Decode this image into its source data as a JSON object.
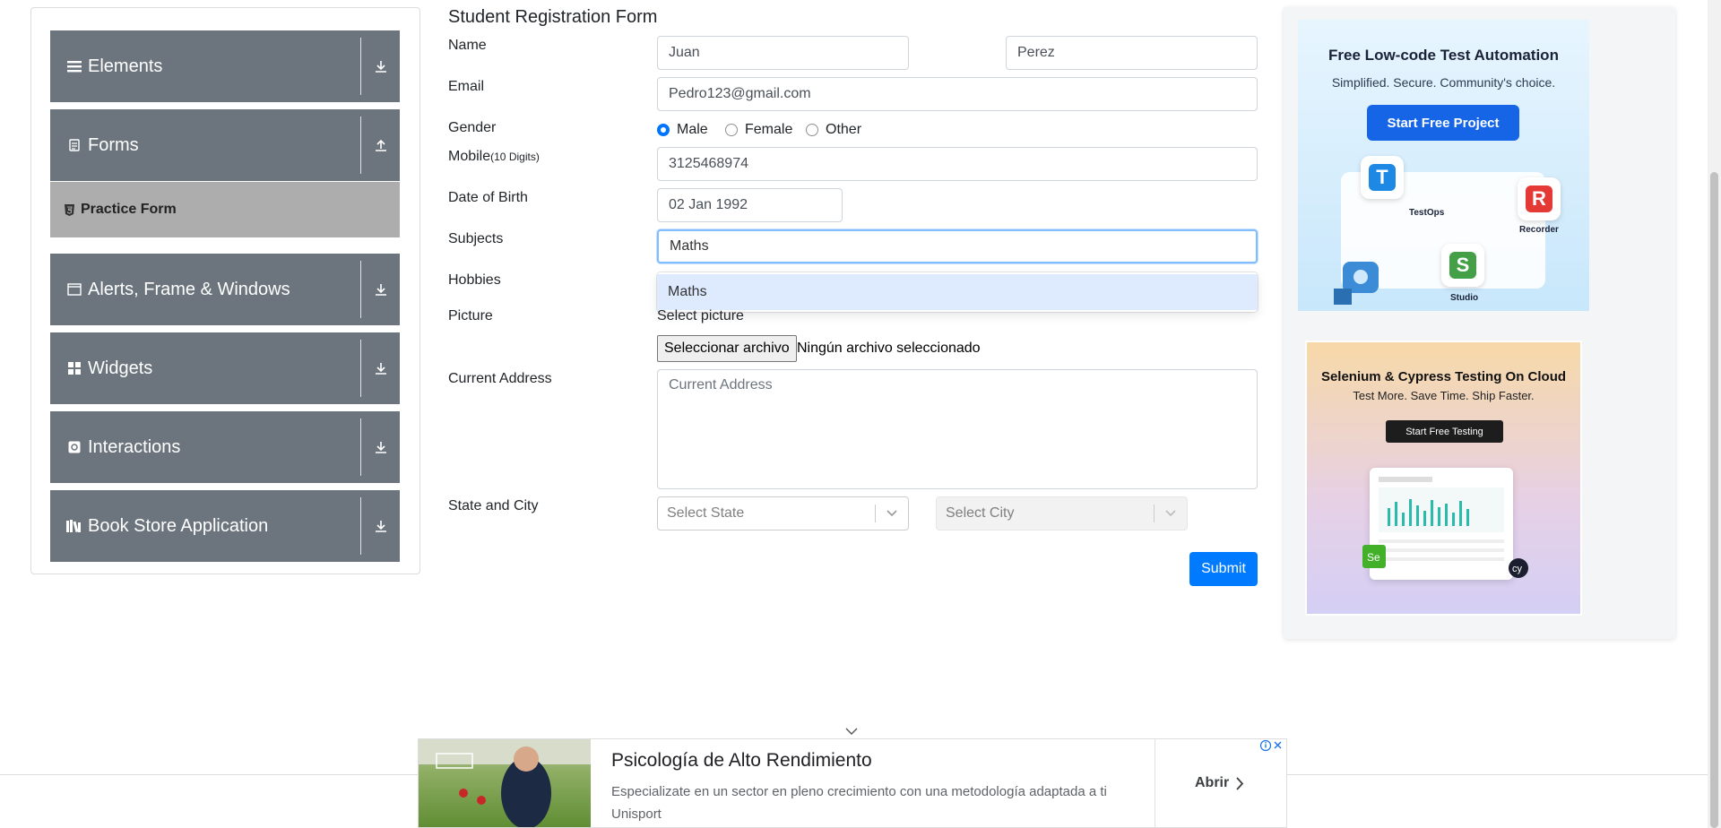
{
  "sidebar": {
    "groups": [
      {
        "label": "Elements",
        "icon": "menu-icon",
        "arrow": "download-icon"
      },
      {
        "label": "Forms",
        "icon": "form-icon",
        "arrow": "upload-icon"
      },
      {
        "label": "Alerts, Frame & Windows",
        "icon": "window-icon",
        "arrow": "download-icon"
      },
      {
        "label": "Widgets",
        "icon": "widgets-icon",
        "arrow": "download-icon"
      },
      {
        "label": "Interactions",
        "icon": "interaction-icon",
        "arrow": "download-icon"
      },
      {
        "label": "Book Store Application",
        "icon": "books-icon",
        "arrow": "download-icon"
      }
    ],
    "active_item": "Practice Form"
  },
  "form": {
    "title": "Student Registration Form",
    "labels": {
      "name": "Name",
      "email": "Email",
      "gender": "Gender",
      "mobile": "Mobile",
      "mobile_hint": "(10 Digits)",
      "dob": "Date of Birth",
      "subjects": "Subjects",
      "hobbies": "Hobbies",
      "picture": "Picture",
      "address": "Current Address",
      "state_city": "State and City"
    },
    "first_name": "Juan",
    "last_name": "Perez",
    "email": "Pedro123@gmail.com",
    "gender_options": [
      "Male",
      "Female",
      "Other"
    ],
    "gender_selected": "Male",
    "mobile": "3125468974",
    "dob": "02 Jan 1992",
    "subjects_input": "Maths",
    "subjects_suggestion": "Maths",
    "picture_caption": "Select picture",
    "file_button": "Seleccionar archivo",
    "file_status": "Ningún archivo seleccionado",
    "address_placeholder": "Current Address",
    "state_placeholder": "Select State",
    "city_placeholder": "Select City",
    "submit": "Submit"
  },
  "ads": {
    "ad1": {
      "headline": "Free Low-code Test Automation",
      "sub": "Simplified. Secure. Community's choice.",
      "button": "Start Free Project",
      "labels": [
        "TestOps",
        "Recorder",
        "Studio"
      ]
    },
    "ad2": {
      "headline": "Selenium & Cypress Testing On Cloud",
      "sub": "Test More. Save Time. Ship Faster.",
      "button": "Start Free Testing"
    },
    "banner": {
      "title": "Psicología de Alto Rendimiento",
      "desc": "Especializate en un sector en pleno crecimiento con una metodología adaptada a ti",
      "advertiser": "Unisport",
      "cta": "Abrir"
    }
  },
  "colors": {
    "sidebar_group": "#6c757d",
    "sidebar_active": "#adadad",
    "primary": "#007bff",
    "suggestion_bg": "#deebff"
  }
}
